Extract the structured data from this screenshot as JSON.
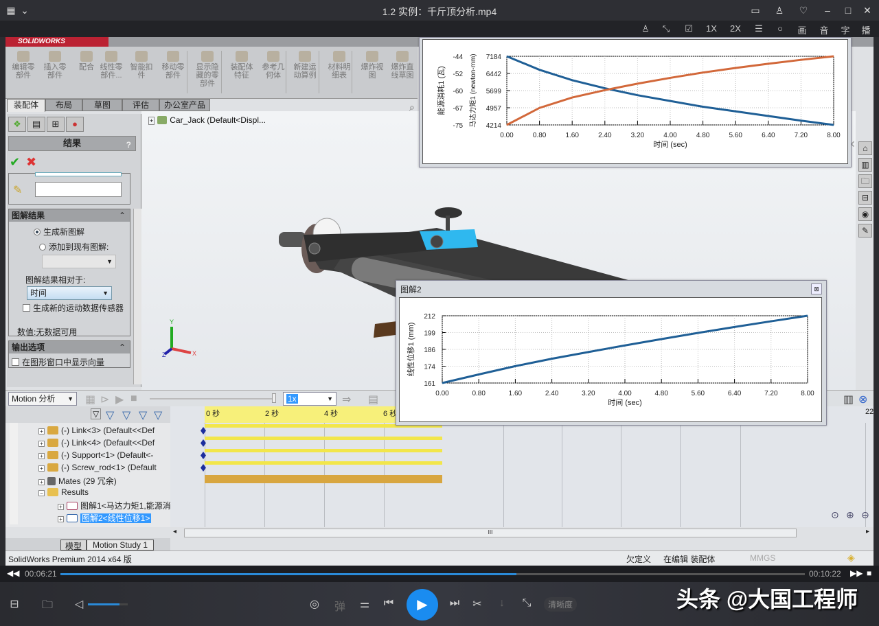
{
  "player": {
    "title": "1.2 实例：千斤顶分析.mp4",
    "title_icons": [
      "layout-icon",
      "chevron-down-icon"
    ],
    "window_buttons": [
      "feedback-icon",
      "pin-icon",
      "skin-icon",
      "minimize-icon",
      "maximize-icon",
      "close-icon"
    ],
    "toolbar": [
      "pin-icon",
      "resize-icon",
      "screenshot-icon",
      "1X",
      "2X",
      "list-icon",
      "bulb-icon",
      "画",
      "音",
      "字",
      "播"
    ],
    "time_current": "00:06:21",
    "time_total": "00:10:22",
    "progress": 0.613,
    "volume": 0.8,
    "controls": {
      "bullet": "弹",
      "quality": "清晰度"
    },
    "watermark": "头条 @大国工程师"
  },
  "sw": {
    "logo": "SOLIDWORKS",
    "ribbon": [
      {
        "label": "编辑零\n部件"
      },
      {
        "label": "插入零\n部件"
      },
      {
        "label": "配合"
      },
      {
        "label": "线性零\n部件..."
      },
      {
        "label": "智能扣\n件"
      },
      {
        "label": "移动零\n部件"
      },
      {
        "label": "显示隐\n藏的零\n部件"
      },
      {
        "label": "装配体\n特征"
      },
      {
        "label": "参考几\n何体"
      },
      {
        "label": "新建运\n动算例"
      },
      {
        "label": "材料明\n细表"
      },
      {
        "label": "爆炸视\n图"
      },
      {
        "label": "爆炸直\n线草图"
      }
    ],
    "tabs": [
      "装配体",
      "布局",
      "草图",
      "评估",
      "办公室产品"
    ],
    "active_tab": "装配体",
    "pm": {
      "title": "结果",
      "help": "?",
      "section_plot": "图解结果",
      "radio_new": "生成新图解",
      "radio_add": "添加到现有图解:",
      "relative_label": "图解结果相对于:",
      "relative_value": "时间",
      "create_sensor": "生成新的运动数据传感器",
      "value_text": "数值:无数据可用",
      "section_output": "输出选项",
      "show_vector": "在图形窗口中显示向量"
    },
    "tree_root": "Car_Jack  (Default<Displ...",
    "motion": {
      "study_type": "Motion 分析",
      "speed": "1x",
      "ruler": [
        "0 秒",
        "2 秒",
        "4 秒",
        "6 秒"
      ],
      "ruler_right": "22",
      "tree": [
        {
          "label": "(-) Link<3> (Default<<Def"
        },
        {
          "label": "(-) Link<4> (Default<<Def"
        },
        {
          "label": "(-) Support<1> (Default<-"
        },
        {
          "label": "(-) Screw_rod<1> (Default"
        },
        {
          "label": "Mates (29 冗余)"
        },
        {
          "label": "Results"
        },
        {
          "label": "图解1<马达力矩1,能源消"
        },
        {
          "label": "图解2<线性位移1>"
        }
      ],
      "selected": "图解2<线性位移1>"
    },
    "bottom_tabs": [
      "模型",
      "Motion Study 1"
    ],
    "status": {
      "product": "SolidWorks Premium 2014 x64 版",
      "state1": "欠定义",
      "state2": "在编辑 装配体",
      "units": "MMGS"
    }
  },
  "chart_data": [
    {
      "type": "line",
      "title": "图解1",
      "xlabel": "时间 (sec)",
      "ylabel_left": "能源消耗1 (瓦)",
      "ylabel_right": "马达力矩1 (newton-mm)",
      "x_ticks": [
        "0.00",
        "0.80",
        "1.60",
        "2.40",
        "3.20",
        "4.00",
        "4.80",
        "5.60",
        "6.40",
        "7.20",
        "8.00"
      ],
      "xlim": [
        0,
        8
      ],
      "y1_ticks": [
        "-44",
        "-52",
        "-60",
        "-67",
        "-75"
      ],
      "y1lim": [
        -75,
        -44
      ],
      "y2_ticks": [
        "7184",
        "6442",
        "5699",
        "4957",
        "4214"
      ],
      "y2lim": [
        4214,
        7184
      ],
      "grid": true,
      "series": [
        {
          "name": "马达力矩1",
          "color": "#1f5f96",
          "axis": "y2",
          "x": [
            0,
            0.8,
            1.6,
            2.4,
            3.2,
            4.0,
            4.8,
            5.6,
            6.4,
            7.2,
            8.0
          ],
          "y": [
            7184,
            6600,
            6150,
            5800,
            5500,
            5250,
            5000,
            4800,
            4600,
            4400,
            4214
          ]
        },
        {
          "name": "能源消耗1",
          "color": "#d2683a",
          "axis": "y2",
          "x": [
            0,
            0.8,
            1.6,
            2.4,
            3.2,
            4.0,
            4.8,
            5.6,
            6.4,
            7.2,
            8.0
          ],
          "y": [
            4214,
            4950,
            5400,
            5720,
            6000,
            6250,
            6480,
            6680,
            6860,
            7030,
            7184
          ]
        }
      ]
    },
    {
      "type": "line",
      "title": "图解2",
      "xlabel": "时间 (sec)",
      "ylabel": "线性位移1 (mm)",
      "x_ticks": [
        "0.00",
        "0.80",
        "1.60",
        "2.40",
        "3.20",
        "4.00",
        "4.80",
        "5.60",
        "6.40",
        "7.20",
        "8.00"
      ],
      "xlim": [
        0,
        8
      ],
      "y_ticks": [
        "212",
        "199",
        "186",
        "174",
        "161"
      ],
      "ylim": [
        161,
        212
      ],
      "grid": true,
      "series": [
        {
          "name": "线性位移1",
          "color": "#1f5f96",
          "x": [
            0,
            0.8,
            1.6,
            2.4,
            3.2,
            4.0,
            4.8,
            5.6,
            6.4,
            7.2,
            8.0
          ],
          "y": [
            161,
            167.5,
            173.8,
            179.4,
            184.5,
            189.5,
            194.3,
            199,
            203.5,
            207.8,
            212
          ]
        }
      ]
    }
  ]
}
